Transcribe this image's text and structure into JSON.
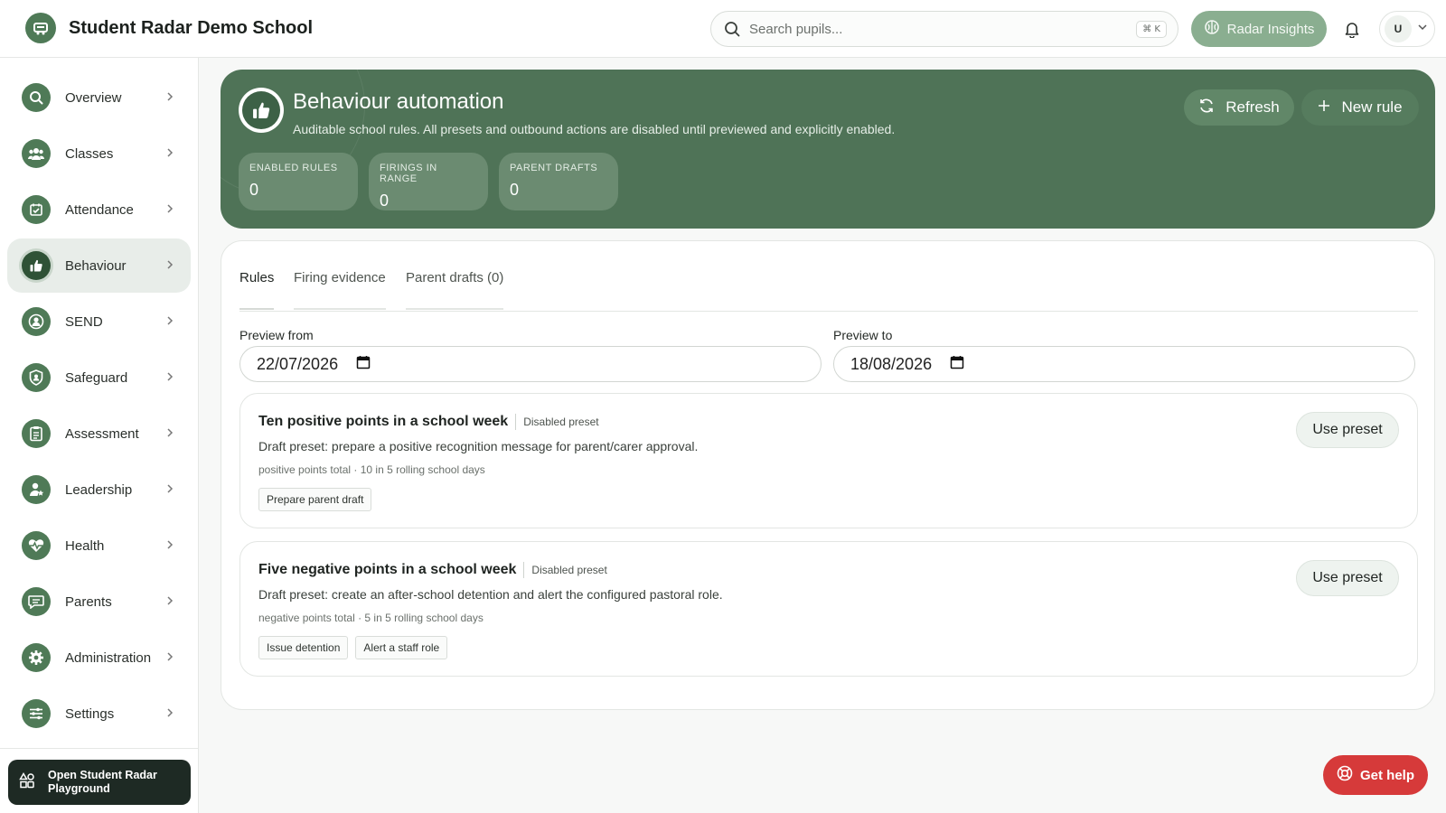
{
  "app": {
    "school_name": "Student Radar Demo School"
  },
  "header": {
    "search_placeholder": "Search pupils...",
    "shortcut": "⌘ K",
    "insights_label": "Radar Insights",
    "avatar_initial": "U"
  },
  "sidebar": {
    "items": [
      {
        "label": "Overview",
        "icon": "search-icon"
      },
      {
        "label": "Classes",
        "icon": "users-icon"
      },
      {
        "label": "Attendance",
        "icon": "calendar-check-icon"
      },
      {
        "label": "Behaviour",
        "icon": "thumbs-up-icon",
        "active": true
      },
      {
        "label": "SEND",
        "icon": "person-circle-icon"
      },
      {
        "label": "Safeguard",
        "icon": "shield-icon"
      },
      {
        "label": "Assessment",
        "icon": "clipboard-icon"
      },
      {
        "label": "Leadership",
        "icon": "person-star-icon"
      },
      {
        "label": "Health",
        "icon": "heart-pulse-icon"
      },
      {
        "label": "Parents",
        "icon": "chat-icon"
      },
      {
        "label": "Administration",
        "icon": "gear-icon"
      },
      {
        "label": "Settings",
        "icon": "sliders-icon"
      }
    ],
    "playground_label": "Open Student Radar Playground"
  },
  "hero": {
    "title": "Behaviour automation",
    "subtitle": "Auditable school rules. All presets and outbound actions are disabled until previewed and explicitly enabled.",
    "refresh_label": "Refresh",
    "new_rule_label": "New rule",
    "stats": [
      {
        "label": "ENABLED RULES",
        "value": "0"
      },
      {
        "label": "FIRINGS IN RANGE",
        "value": "0"
      },
      {
        "label": "PARENT DRAFTS",
        "value": "0"
      }
    ],
    "color": "#4f7357"
  },
  "tabs": [
    {
      "label": "Rules",
      "active": true
    },
    {
      "label": "Firing evidence"
    },
    {
      "label": "Parent drafts (0)"
    }
  ],
  "preview": {
    "from_label": "Preview from",
    "from_value": "22/07/2026",
    "to_label": "Preview to",
    "to_value": "18/08/2026"
  },
  "rules": [
    {
      "title": "Ten positive points in a school week",
      "badge": "Disabled preset",
      "description": "Draft preset: prepare a positive recognition message for parent/carer approval.",
      "meta": "positive points total · 10 in 5 rolling school days",
      "actions": [
        "Prepare parent draft"
      ],
      "button": "Use preset"
    },
    {
      "title": "Five negative points in a school week",
      "badge": "Disabled preset",
      "description": "Draft preset: create an after-school detention and alert the configured pastoral role.",
      "meta": "negative points total · 5 in 5 rolling school days",
      "actions": [
        "Issue detention",
        "Alert a staff role"
      ],
      "button": "Use preset"
    }
  ],
  "help_label": "Get help",
  "colors": {
    "brand": "#4f7a57",
    "help": "#d63a3a",
    "insights": "#8aae90"
  }
}
